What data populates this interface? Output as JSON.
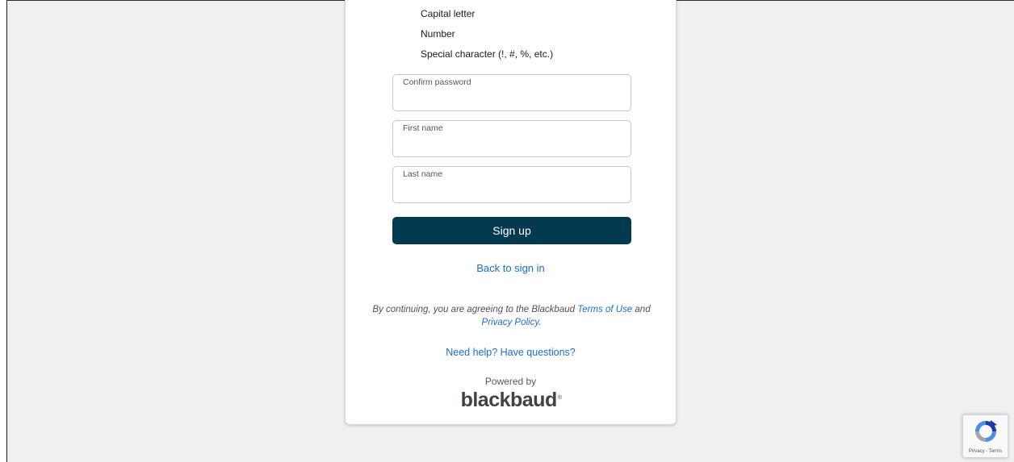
{
  "requirements": [
    {
      "label": "Capital letter"
    },
    {
      "label": "Number"
    },
    {
      "label": "Special character (!, #, %, etc.)"
    }
  ],
  "fields": {
    "confirm_password": {
      "label": "Confirm password",
      "value": ""
    },
    "first_name": {
      "label": "First name",
      "value": ""
    },
    "last_name": {
      "label": "Last name",
      "value": ""
    }
  },
  "signup_button": {
    "label": "Sign up"
  },
  "back_link": {
    "label": "Back to sign in"
  },
  "legal": {
    "prefix": "By continuing, you are agreeing to the Blackbaud",
    "terms_link": "Terms of Use",
    "and": "and",
    "privacy_link": "Privacy Policy",
    "suffix": "."
  },
  "help_link": {
    "label": "Need help? Have questions?"
  },
  "footer": {
    "powered_by": "Powered by",
    "brand": "blackbaud",
    "brand_mark": "®"
  },
  "recaptcha": {
    "icon": "recaptcha-icon",
    "privacy": "Privacy",
    "separator": " - ",
    "terms": "Terms"
  },
  "colors": {
    "background": "#f0f0f2",
    "card": "#ffffff",
    "primary_button": "#033a4f",
    "link": "#1c6ed0",
    "brand_text": "#3f4246"
  }
}
